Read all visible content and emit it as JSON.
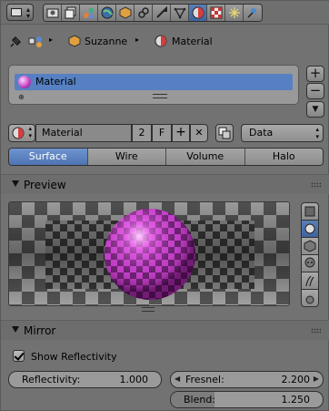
{
  "breadcrumb": {
    "object": "Suzanne",
    "data": "Material"
  },
  "slot_list": {
    "items": [
      {
        "label": "Material"
      }
    ]
  },
  "datablock": {
    "name": "Material",
    "users": "2",
    "fake_user": "F",
    "link_target": "Data"
  },
  "material_types": {
    "tabs": [
      "Surface",
      "Wire",
      "Volume",
      "Halo"
    ],
    "active": "Surface"
  },
  "preview": {
    "title": "Preview"
  },
  "mirror": {
    "title": "Mirror",
    "show_reflectivity_label": "Show Reflectivity",
    "show_reflectivity_checked": true,
    "reflectivity_label": "Reflectivity:",
    "reflectivity_value": "1.000",
    "fresnel_label": "Fresnel:",
    "fresnel_value": "2.200",
    "blend_label": "Blend:",
    "blend_value": "1.250"
  },
  "colors": {
    "accent": "#5680c2",
    "material": "#c040c0"
  },
  "icons": [
    "editor-type-icon",
    "render-icon",
    "render-layers-icon",
    "scene-icon",
    "world-icon",
    "object-icon",
    "constraints-icon",
    "modifiers-icon",
    "object-data-icon",
    "material-icon",
    "texture-icon",
    "particles-icon",
    "physics-icon",
    "pin-icon",
    "mesh-icon",
    "add-icon",
    "remove-icon",
    "browse-icon",
    "fake-user-icon",
    "copy-icon",
    "unlink-icon"
  ]
}
